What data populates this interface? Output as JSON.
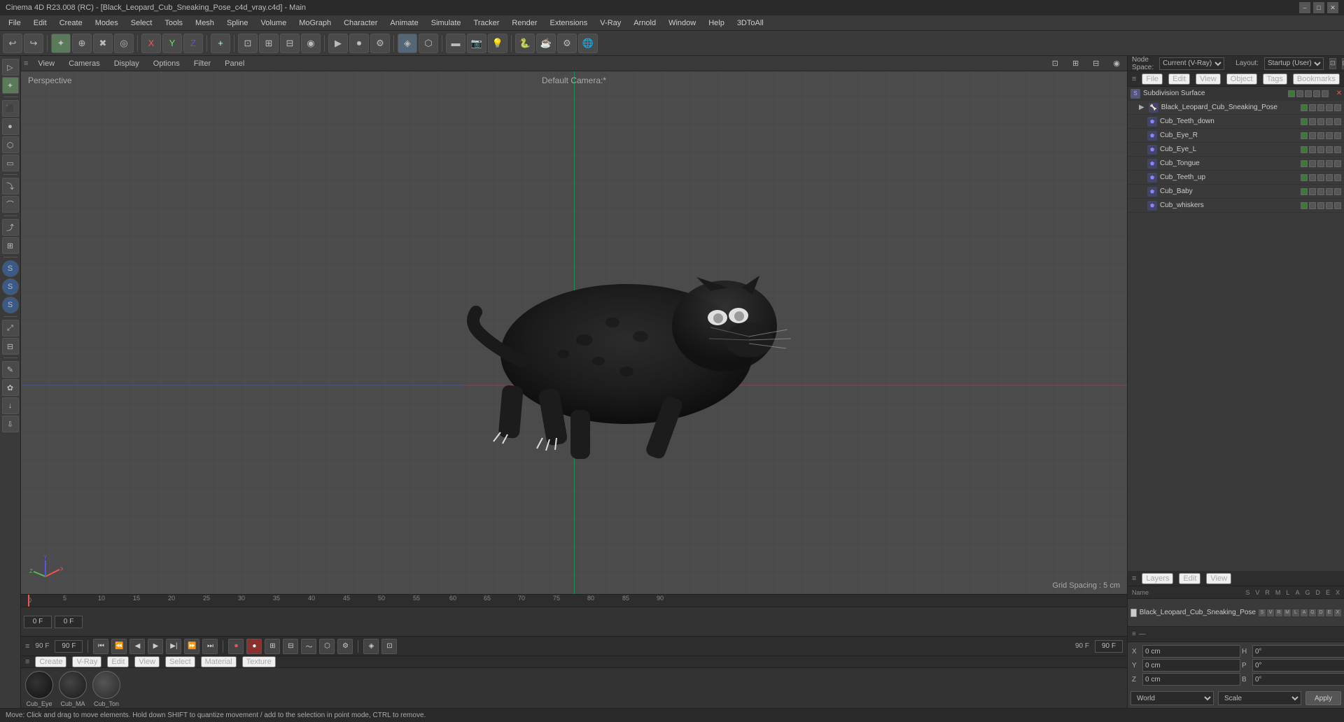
{
  "title_bar": {
    "title": "Cinema 4D R23.008 (RC) - [Black_Leopard_Cub_Sneaking_Pose_c4d_vray.c4d] - Main",
    "minimize": "–",
    "maximize": "□",
    "close": "✕"
  },
  "menu_bar": {
    "items": [
      "File",
      "Edit",
      "Create",
      "Modes",
      "Select",
      "Tools",
      "Mesh",
      "Spline",
      "Volume",
      "MoGraph",
      "Character",
      "Animate",
      "Simulate",
      "Tracker",
      "Render",
      "Extensions",
      "V-Ray",
      "Arnold",
      "Window",
      "Help",
      "3DToAll"
    ]
  },
  "toolbar": {
    "tools": [
      "↩",
      "↪",
      "✦",
      "⊕",
      "✖",
      "◎",
      "⊗",
      "⊙",
      "⊡",
      "→",
      "↗",
      "⤢",
      "⊞",
      "⊟",
      "▶",
      "⏺",
      "⚙",
      "🔷",
      "🔶",
      "🔸",
      "⬡",
      "◈",
      "▼",
      "⚡",
      "📊",
      "📷",
      "💡",
      "💻",
      "⚙",
      "🌐"
    ]
  },
  "viewport": {
    "label": "Perspective",
    "camera_label": "Default Camera:*",
    "grid_spacing": "Grid Spacing : 5 cm",
    "header_items": [
      "View",
      "Cameras",
      "Display",
      "Options",
      "Filter",
      "Panel"
    ],
    "icons_right": [
      "⊡",
      "⊞",
      "⊟",
      "◉"
    ]
  },
  "right_panel": {
    "node_space_label": "Node Space:",
    "node_space_value": "Current (V-Ray)",
    "layout_label": "Layout:",
    "layout_value": "Startup (User)"
  },
  "object_manager": {
    "header_items": [
      "File",
      "Edit",
      "View",
      "Object",
      "Tags",
      "Bookmarks"
    ],
    "top_item": {
      "name": "Subdivision Surface",
      "icon": "S"
    },
    "items": [
      {
        "name": "Black_Leopard_Cub_Sneaking_Pose",
        "indent": 1,
        "icon": "▶"
      },
      {
        "name": "Cub_Teeth_down",
        "indent": 2,
        "icon": "⬟"
      },
      {
        "name": "Cub_Eye_R",
        "indent": 2,
        "icon": "⬟"
      },
      {
        "name": "Cub_Eye_L",
        "indent": 2,
        "icon": "⬟"
      },
      {
        "name": "Cub_Tongue",
        "indent": 2,
        "icon": "⬟"
      },
      {
        "name": "Cub_Teeth_up",
        "indent": 2,
        "icon": "⬟"
      },
      {
        "name": "Cub_Baby",
        "indent": 2,
        "icon": "⬟"
      },
      {
        "name": "Cub_whiskers",
        "indent": 2,
        "icon": "⬟"
      }
    ]
  },
  "layers_panel": {
    "header_items": [
      "Layers",
      "Edit",
      "View"
    ],
    "columns": {
      "name": "Name",
      "cols": [
        "S",
        "V",
        "R",
        "M",
        "L",
        "A",
        "G",
        "D",
        "E",
        "X"
      ]
    },
    "layer_item": {
      "name": "Black_Leopard_Cub_Sneaking_Pose",
      "color": "#ccc"
    }
  },
  "coordinates": {
    "position": {
      "x": "0 cm",
      "y": "0 cm",
      "z": "0 cm"
    },
    "rotation": {
      "h": "0°",
      "p": "0°",
      "b": "0°"
    },
    "labels": {
      "pos_x": "X",
      "pos_y": "Y",
      "pos_z": "Z",
      "h": "H",
      "p": "P",
      "b": "B"
    },
    "coord_rows": [
      {
        "left_label": "X",
        "left_val": "0 cm",
        "right_label": "H",
        "right_val": "0°"
      },
      {
        "left_label": "Y",
        "left_val": "0 cm",
        "right_label": "P",
        "right_val": "0°"
      },
      {
        "left_label": "Z",
        "left_val": "0 cm",
        "right_label": "B",
        "right_val": "0°"
      }
    ],
    "world_label": "World",
    "scale_label": "Scale",
    "apply_label": "Apply"
  },
  "material_panel": {
    "header_items": [
      "Create",
      "V-Ray",
      "Edit",
      "View",
      "Select",
      "Material",
      "Texture"
    ],
    "materials": [
      {
        "name": "Cub_Eye",
        "color": "#1a1a1a"
      },
      {
        "name": "Cub_MA",
        "color": "#2a2a2a"
      },
      {
        "name": "Cub_Ton",
        "color": "#333"
      }
    ]
  },
  "animation": {
    "current_frame": "0 F",
    "start_frame": "0 F",
    "end_frame": "90 F",
    "end_frame2": "90 F",
    "frame_input1": "0 F",
    "frame_input2": "0 F",
    "display_frame": "90 F",
    "display_frame2": "90 F"
  },
  "status_bar": {
    "message": "Move: Click and drag to move elements. Hold down SHIFT to quantize movement / add to the selection in point mode, CTRL to remove."
  },
  "left_tools": {
    "tools": [
      "▷",
      "⊕",
      "↔",
      "↺",
      "⊡",
      "▭",
      "◇",
      "⑦",
      "⑧",
      "⑨",
      "⑩",
      "⑪",
      "⑫",
      "⑬",
      "⑭",
      "⑮",
      "⑯",
      "⑰",
      "⑱",
      "⑲",
      "⑳"
    ]
  }
}
